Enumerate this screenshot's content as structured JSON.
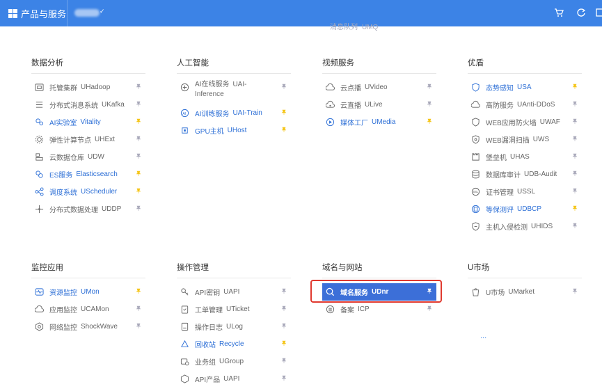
{
  "topbar": {
    "brand_label": "产品与服务",
    "caret": "✓",
    "icons": [
      "cart-icon",
      "refresh-icon",
      "window-icon"
    ]
  },
  "ghost_row": {
    "name": "消息队列",
    "code": "UMQ"
  },
  "colors": {
    "topbar": "#3c83e6",
    "favorite": "#2d6fd6",
    "pin_favorite": "#f5c518",
    "pin_normal": "#aab",
    "highlight_border": "#e0392f",
    "active_bg": "#3c6fd8"
  },
  "sections": {
    "data": {
      "title": "数据分析",
      "items": [
        {
          "name": "托管集群",
          "code": "UHadoop",
          "icon": "cluster-icon",
          "fav": false
        },
        {
          "name": "分布式消息系统",
          "code": "UKafka",
          "icon": "message-icon",
          "fav": false
        },
        {
          "name": "AI实验室",
          "code": "Vitality",
          "icon": "ai-lab-icon",
          "fav": true
        },
        {
          "name": "弹性计算节点",
          "code": "UHExt",
          "icon": "gear-icon",
          "fav": false
        },
        {
          "name": "云数据仓库",
          "code": "UDW",
          "icon": "warehouse-icon",
          "fav": false
        },
        {
          "name": "ES服务",
          "code": "Elasticsearch",
          "icon": "es-icon",
          "fav": true
        },
        {
          "name": "调度系统",
          "code": "UScheduler",
          "icon": "scheduler-icon",
          "fav": true
        },
        {
          "name": "分布式数据处理",
          "code": "UDDP",
          "icon": "network-icon",
          "fav": false
        }
      ]
    },
    "ai": {
      "title": "人工智能",
      "items": [
        {
          "name": "AI在线服务",
          "code": "UAI-",
          "code2": "Inference",
          "icon": "brain-icon",
          "fav": false
        },
        {
          "name": "AI训练服务",
          "code": "UAI-Train",
          "icon": "ai-icon",
          "fav": true
        },
        {
          "name": "GPU主机",
          "code": "UHost",
          "icon": "gpu-icon",
          "fav": true
        }
      ]
    },
    "video": {
      "title": "视频服务",
      "items": [
        {
          "name": "云点播",
          "code": "UVideo",
          "icon": "cloud-play-icon",
          "fav": false
        },
        {
          "name": "云直播",
          "code": "ULive",
          "icon": "cloud-live-icon",
          "fav": false
        },
        {
          "name": "媒体工厂",
          "code": "UMedia",
          "icon": "media-icon",
          "fav": true
        }
      ]
    },
    "security": {
      "title": "优盾",
      "items": [
        {
          "name": "态势感知",
          "code": "USA",
          "icon": "shield-icon",
          "fav": true
        },
        {
          "name": "高防服务",
          "code": "UAnti-DDoS",
          "icon": "cloud-shield-icon",
          "fav": false
        },
        {
          "name": "WEB应用防火墙",
          "code": "UWAF",
          "icon": "firewall-icon",
          "fav": false
        },
        {
          "name": "WEB漏洞扫描",
          "code": "UWS",
          "icon": "scan-icon",
          "fav": false
        },
        {
          "name": "堡垒机",
          "code": "UHAS",
          "icon": "fortress-icon",
          "fav": false
        },
        {
          "name": "数据库审计",
          "code": "UDB-Audit",
          "icon": "database-icon",
          "fav": false
        },
        {
          "name": "证书管理",
          "code": "USSL",
          "icon": "ssl-icon",
          "fav": false
        },
        {
          "name": "等保测评",
          "code": "UDBCP",
          "icon": "audit-icon",
          "fav": true
        },
        {
          "name": "主机入侵检测",
          "code": "UHIDS",
          "icon": "intrusion-icon",
          "fav": false
        }
      ]
    },
    "monitor": {
      "title": "监控应用",
      "items": [
        {
          "name": "资源监控",
          "code": "UMon",
          "icon": "pulse-icon",
          "fav": true
        },
        {
          "name": "应用监控",
          "code": "UCAMon",
          "icon": "app-monitor-icon",
          "fav": false
        },
        {
          "name": "网络监控",
          "code": "ShockWave",
          "icon": "net-monitor-icon",
          "fav": false
        }
      ]
    },
    "ops": {
      "title": "操作管理",
      "items": [
        {
          "name": "API密钥",
          "code": "UAPI",
          "icon": "key-icon",
          "fav": false
        },
        {
          "name": "工单管理",
          "code": "UTicket",
          "icon": "ticket-icon",
          "fav": false
        },
        {
          "name": "操作日志",
          "code": "ULog",
          "icon": "log-icon",
          "fav": false
        },
        {
          "name": "回收站",
          "code": "Recycle",
          "icon": "recycle-icon",
          "fav": true
        },
        {
          "name": "业务组",
          "code": "UGroup",
          "icon": "group-icon",
          "fav": false
        },
        {
          "name": "API产品",
          "code": "UAPI",
          "icon": "api-icon",
          "fav": false
        }
      ]
    },
    "domain": {
      "title": "域名与网站",
      "items": [
        {
          "name": "域名服务",
          "code": "UDnr",
          "icon": "domain-icon",
          "fav": true,
          "active": true
        },
        {
          "name": "备案",
          "code": "ICP",
          "icon": "icp-icon",
          "fav": false
        }
      ]
    },
    "market": {
      "title": "U市场",
      "items": [
        {
          "name": "U市场",
          "code": "UMarket",
          "icon": "market-icon",
          "fav": false
        }
      ],
      "more": "..."
    }
  }
}
